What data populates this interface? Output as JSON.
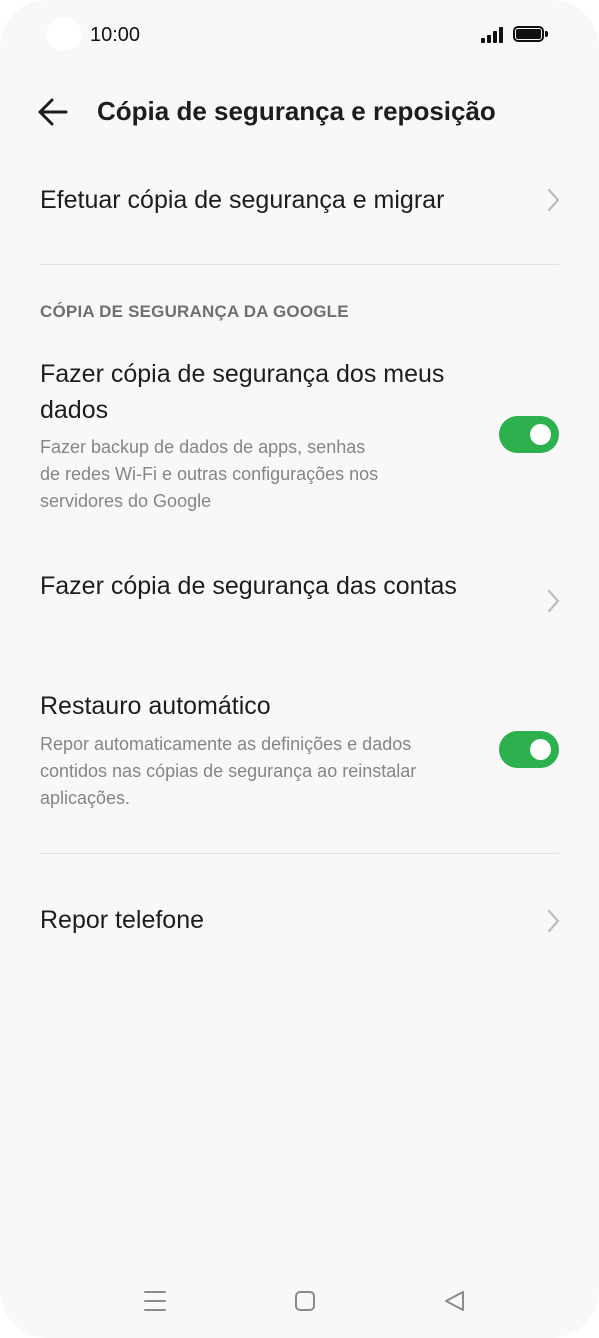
{
  "status_bar": {
    "time": "10:00",
    "signal_icon": "signal-bars-icon",
    "battery_icon": "battery-full-icon"
  },
  "header": {
    "title": "Cópia de segurança e reposição",
    "back_icon": "arrow-left-icon"
  },
  "items": {
    "backup_migrate": {
      "label": "Efetuar cópia de segurança e migrar"
    },
    "google_section": {
      "header": "CÓPIA DE SEGURANÇA DA GOOGLE"
    },
    "backup_data": {
      "label_line1": "Fazer cópia de segurança dos meus",
      "label_line2": "dados",
      "desc_line1": "Fazer backup de dados de apps, senhas",
      "desc_line2": "de redes Wi-Fi e outras configurações nos",
      "desc_line3": "servidores do Google",
      "enabled": true
    },
    "backup_accounts": {
      "label": "Fazer cópia de segurança das contas"
    },
    "auto_restore": {
      "label": "Restauro automático",
      "desc_line1": "Repor automaticamente as definições e dados",
      "desc_line2": "contidos nas cópias de segurança ao reinstalar",
      "desc_line3": "aplicações.",
      "enabled": true
    },
    "reset_phone": {
      "label": "Repor telefone"
    }
  },
  "nav_bar": {
    "menu_icon": "menu-icon",
    "home_icon": "home-square-icon",
    "back_icon": "back-triangle-icon"
  },
  "colors": {
    "background": "#f8f8f8",
    "toggle_on": "#2db14f",
    "secondary_text": "#858585",
    "section_text": "#6f6f6f",
    "divider": "#e3e3e3"
  }
}
